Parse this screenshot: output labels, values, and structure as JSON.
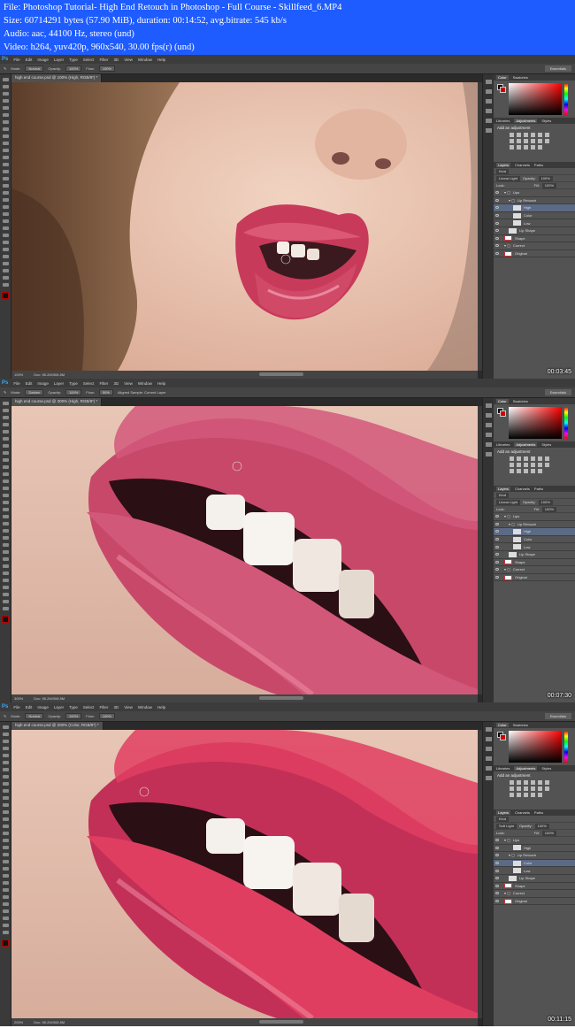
{
  "header": {
    "lines": [
      "File: Photoshop Tutorial- High End Retouch in Photoshop - Full Course - Skillfeed_6.MP4",
      "Size: 60714291 bytes (57.90 MiB), duration: 00:14:52, avg.bitrate: 545 kb/s",
      "Audio: aac, 44100 Hz, stereo (und)",
      "Video: h264, yuv420p, 960x540, 30.00 fps(r) (und)"
    ]
  },
  "menu": {
    "logo": "Ps",
    "items": [
      "File",
      "Edit",
      "Image",
      "Layer",
      "Type",
      "Select",
      "Filter",
      "3D",
      "View",
      "Window",
      "Help"
    ]
  },
  "workspace_label": "Essentials",
  "panels_common": {
    "color_tab": "Color",
    "swatches_tab": "Swatches",
    "libraries_tab": "Libraries",
    "adjustments_tab": "Adjustments",
    "styles_tab": "Styles",
    "add_adjustment": "Add an adjustment",
    "layers_tab": "Layers",
    "channels_tab": "Channels",
    "paths_tab": "Paths",
    "kind_label": "Kind",
    "opacity_label": "Opacity:",
    "opacity_value": "100%",
    "lock_label": "Lock:",
    "fill_label": "Fill:",
    "fill_value": "100%"
  },
  "frames": [
    {
      "options": {
        "mode_label": "Mode:",
        "mode": "Normal",
        "opacity_label": "Opacity:",
        "opacity": "100%",
        "flow_label": "Flow:",
        "flow": "100%",
        "extra": ""
      },
      "doc_tab": "high end course.psd @ 100% (High, RGB/8*) *",
      "blend": "Linear Light",
      "status": {
        "zoom": "100%",
        "doc": "Doc: 55.2M/308.5M"
      },
      "timestamp": "00:03:45",
      "layers": [
        {
          "name": "Lips",
          "indent": 0,
          "thumb": "folder",
          "selected": false
        },
        {
          "name": "Lip Retouch",
          "indent": 1,
          "thumb": "folder",
          "selected": false
        },
        {
          "name": "High",
          "indent": 2,
          "thumb": "plain",
          "selected": true
        },
        {
          "name": "Color",
          "indent": 2,
          "thumb": "plain",
          "selected": false
        },
        {
          "name": "Low",
          "indent": 2,
          "thumb": "plain",
          "selected": false
        },
        {
          "name": "Lip Shape",
          "indent": 1,
          "thumb": "plain",
          "selected": false
        },
        {
          "name": "Shape",
          "indent": 0,
          "thumb": "red",
          "selected": false
        },
        {
          "name": "Correct",
          "indent": 0,
          "thumb": "folder",
          "selected": false
        },
        {
          "name": "Original",
          "indent": 0,
          "thumb": "red",
          "selected": false
        }
      ]
    },
    {
      "options": {
        "mode_label": "Mode:",
        "mode": "Darken",
        "opacity_label": "Opacity:",
        "opacity": "100%",
        "flow_label": "Flow:",
        "flow": "50%",
        "extra": "Aligned  Sample: Current Layer"
      },
      "doc_tab": "high end course.psd @ 300% (High, RGB/8*) *",
      "blend": "Linear Light",
      "status": {
        "zoom": "300%",
        "doc": "Doc: 55.2M/308.5M"
      },
      "timestamp": "00:07:30",
      "layers": [
        {
          "name": "Lips",
          "indent": 0,
          "thumb": "folder",
          "selected": false
        },
        {
          "name": "Lip Retouch",
          "indent": 1,
          "thumb": "folder",
          "selected": false
        },
        {
          "name": "High",
          "indent": 2,
          "thumb": "plain",
          "selected": true
        },
        {
          "name": "Color",
          "indent": 2,
          "thumb": "plain",
          "selected": false
        },
        {
          "name": "Low",
          "indent": 2,
          "thumb": "plain",
          "selected": false
        },
        {
          "name": "Lip Shape",
          "indent": 1,
          "thumb": "plain",
          "selected": false
        },
        {
          "name": "Shape",
          "indent": 0,
          "thumb": "red",
          "selected": false
        },
        {
          "name": "Correct",
          "indent": 0,
          "thumb": "folder",
          "selected": false
        },
        {
          "name": "Original",
          "indent": 0,
          "thumb": "red",
          "selected": false
        }
      ]
    },
    {
      "options": {
        "mode_label": "Mode:",
        "mode": "Normal",
        "opacity_label": "Opacity:",
        "opacity": "100%",
        "flow_label": "Flow:",
        "flow": "100%",
        "extra": ""
      },
      "doc_tab": "high end course.psd @ 200% (Color, RGB/8*) *",
      "blend": "Soft Light",
      "status": {
        "zoom": "200%",
        "doc": "Doc: 55.2M/308.5M"
      },
      "timestamp": "00:11:15",
      "layers": [
        {
          "name": "Lips",
          "indent": 0,
          "thumb": "folder",
          "selected": false
        },
        {
          "name": "High",
          "indent": 2,
          "thumb": "plain",
          "selected": false
        },
        {
          "name": "Lip Retouch",
          "indent": 1,
          "thumb": "folder",
          "selected": false
        },
        {
          "name": "Color",
          "indent": 2,
          "thumb": "plain",
          "selected": true
        },
        {
          "name": "Low",
          "indent": 2,
          "thumb": "plain",
          "selected": false
        },
        {
          "name": "Lip Shape",
          "indent": 1,
          "thumb": "plain",
          "selected": false
        },
        {
          "name": "Shape",
          "indent": 0,
          "thumb": "red",
          "selected": false
        },
        {
          "name": "Correct",
          "indent": 0,
          "thumb": "folder",
          "selected": false
        },
        {
          "name": "Original",
          "indent": 0,
          "thumb": "red",
          "selected": false
        }
      ]
    }
  ]
}
